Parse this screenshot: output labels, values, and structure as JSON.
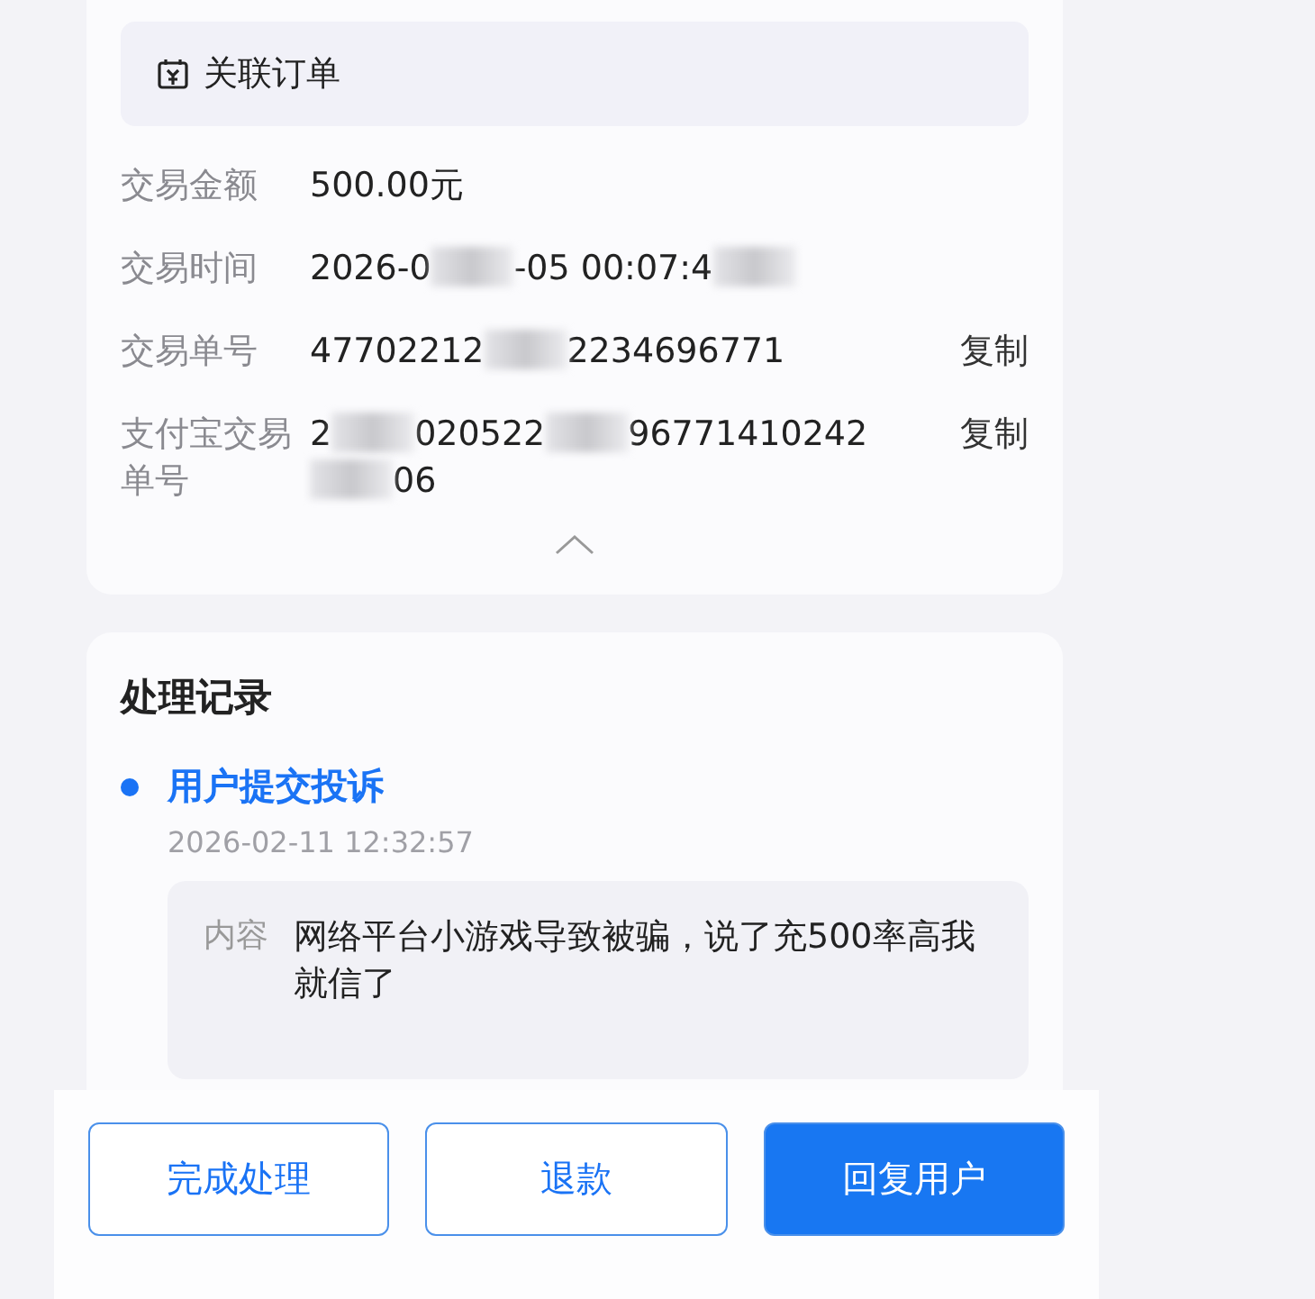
{
  "order_card": {
    "header": {
      "title": "关联订单"
    },
    "rows": [
      {
        "label": "交易金额",
        "segments": [
          {
            "kind": "text",
            "text": "500.00元"
          }
        ]
      },
      {
        "label": "交易时间",
        "segments": [
          {
            "kind": "text",
            "text": "2026-0"
          },
          {
            "kind": "redacted"
          },
          {
            "kind": "text",
            "text": "-05 00:07:4"
          },
          {
            "kind": "redacted"
          }
        ]
      },
      {
        "label": "交易单号",
        "segments": [
          {
            "kind": "text",
            "text": "47702212"
          },
          {
            "kind": "redacted"
          },
          {
            "kind": "text",
            "text": "2234696771"
          }
        ],
        "action": "复制"
      },
      {
        "label": "支付宝交易单号",
        "segments": [
          {
            "kind": "text",
            "text": "2"
          },
          {
            "kind": "redacted"
          },
          {
            "kind": "text",
            "text": "020522"
          },
          {
            "kind": "redacted"
          },
          {
            "kind": "text",
            "text": "96771410242"
          },
          {
            "kind": "redacted"
          },
          {
            "kind": "text",
            "text": "06"
          }
        ],
        "action": "复制"
      }
    ],
    "expanded": true
  },
  "records": {
    "title": "处理记录",
    "items": [
      {
        "title": "用户提交投诉",
        "time": "2026-02-11 12:32:57",
        "content_label": "内容",
        "content": "网络平台小游戏导致被骗，说了充500率高我就信了",
        "color": "#1a73f5"
      }
    ]
  },
  "actions": [
    {
      "label": "完成处理",
      "kind": "outline"
    },
    {
      "label": "退款",
      "kind": "outline"
    },
    {
      "label": "回复用户",
      "kind": "primary"
    }
  ]
}
